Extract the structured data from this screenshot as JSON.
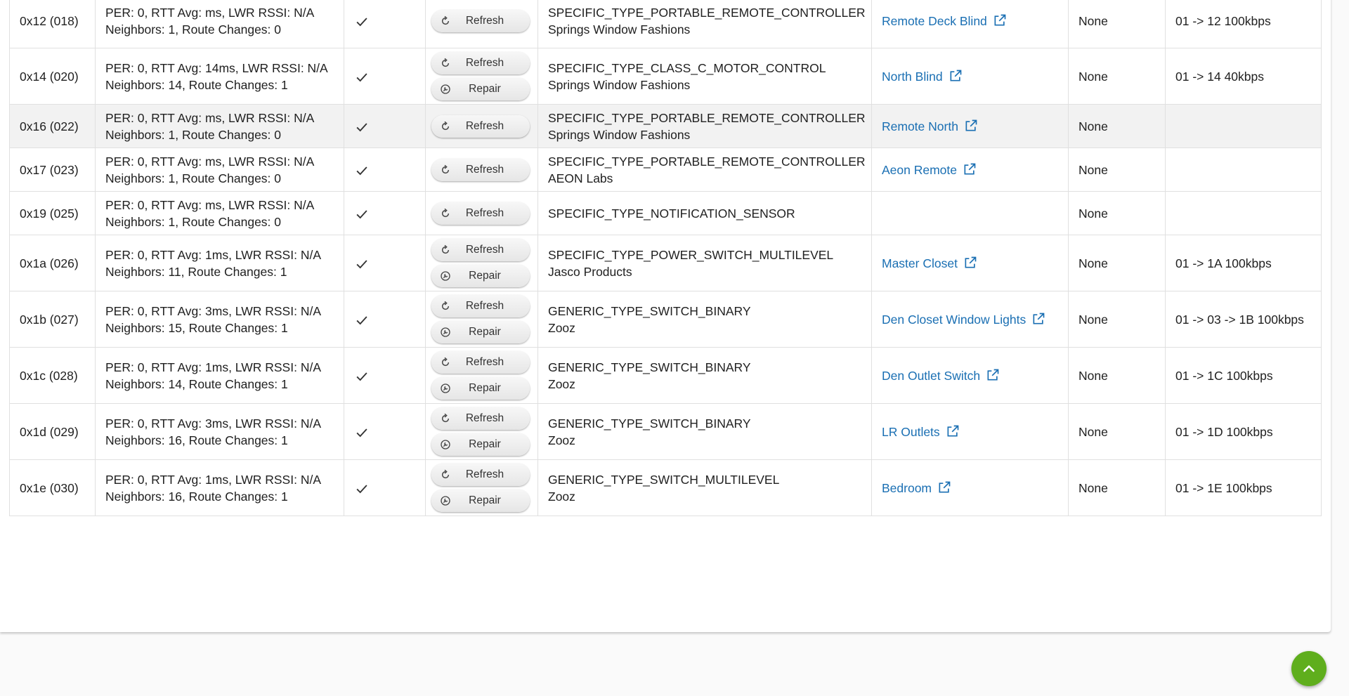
{
  "labels": {
    "refresh": "Refresh",
    "repair": "Repair"
  },
  "colors": {
    "link": "#1a6fb3",
    "fab": "#5fae1d",
    "row_shade": "#f2f2f2"
  },
  "icons": {
    "refresh": "refresh-icon",
    "repair": "repair-icon",
    "check": "check-icon",
    "external": "open-in-new-icon",
    "scroll_top": "chevron-up-icon"
  },
  "rows": [
    {
      "node": "0x12 (018)",
      "stats1": "PER: 0, RTT Avg: ms, LWR RSSI: N/A",
      "stats2": "Neighbors: 1, Route Changes: 0",
      "ready": true,
      "repair": false,
      "type": "SPECIFIC_TYPE_PORTABLE_REMOTE_CONTROLLER",
      "manufacturer": "Springs Window Fashions",
      "device": "Remote Deck Blind",
      "security": "None",
      "route": "01 -> 12 100kbps",
      "shaded": false
    },
    {
      "node": "0x14 (020)",
      "stats1": "PER: 0, RTT Avg: 14ms, LWR RSSI: N/A",
      "stats2": "Neighbors: 14, Route Changes: 1",
      "ready": true,
      "repair": true,
      "type": "SPECIFIC_TYPE_CLASS_C_MOTOR_CONTROL",
      "manufacturer": "Springs Window Fashions",
      "device": "North Blind",
      "security": "None",
      "route": "01 -> 14 40kbps",
      "shaded": false
    },
    {
      "node": "0x16 (022)",
      "stats1": "PER: 0, RTT Avg: ms, LWR RSSI: N/A",
      "stats2": "Neighbors: 1, Route Changes: 0",
      "ready": true,
      "repair": false,
      "type": "SPECIFIC_TYPE_PORTABLE_REMOTE_CONTROLLER",
      "manufacturer": "Springs Window Fashions",
      "device": "Remote North",
      "security": "None",
      "route": "",
      "shaded": true
    },
    {
      "node": "0x17 (023)",
      "stats1": "PER: 0, RTT Avg: ms, LWR RSSI: N/A",
      "stats2": "Neighbors: 1, Route Changes: 0",
      "ready": true,
      "repair": false,
      "type": "SPECIFIC_TYPE_PORTABLE_REMOTE_CONTROLLER",
      "manufacturer": "AEON Labs",
      "device": "Aeon Remote",
      "security": "None",
      "route": "",
      "shaded": false
    },
    {
      "node": "0x19 (025)",
      "stats1": "PER: 0, RTT Avg: ms, LWR RSSI: N/A",
      "stats2": "Neighbors: 1, Route Changes: 0",
      "ready": true,
      "repair": false,
      "type": "SPECIFIC_TYPE_NOTIFICATION_SENSOR",
      "manufacturer": "",
      "device": "",
      "security": "None",
      "route": "",
      "shaded": false
    },
    {
      "node": "0x1a (026)",
      "stats1": "PER: 0, RTT Avg: 1ms, LWR RSSI: N/A",
      "stats2": "Neighbors: 11, Route Changes: 1",
      "ready": true,
      "repair": true,
      "type": "SPECIFIC_TYPE_POWER_SWITCH_MULTILEVEL",
      "manufacturer": "Jasco Products",
      "device": "Master Closet",
      "security": "None",
      "route": "01 -> 1A 100kbps",
      "shaded": false
    },
    {
      "node": "0x1b (027)",
      "stats1": "PER: 0, RTT Avg: 3ms, LWR RSSI: N/A",
      "stats2": "Neighbors: 15, Route Changes: 1",
      "ready": true,
      "repair": true,
      "type": "GENERIC_TYPE_SWITCH_BINARY",
      "manufacturer": "Zooz",
      "device": "Den Closet Window Lights",
      "security": "None",
      "route": "01 -> 03 -> 1B 100kbps",
      "shaded": false
    },
    {
      "node": "0x1c (028)",
      "stats1": "PER: 0, RTT Avg: 1ms, LWR RSSI: N/A",
      "stats2": "Neighbors: 14, Route Changes: 1",
      "ready": true,
      "repair": true,
      "type": "GENERIC_TYPE_SWITCH_BINARY",
      "manufacturer": "Zooz",
      "device": "Den Outlet Switch",
      "security": "None",
      "route": "01 -> 1C 100kbps",
      "shaded": false
    },
    {
      "node": "0x1d (029)",
      "stats1": "PER: 0, RTT Avg: 3ms, LWR RSSI: N/A",
      "stats2": "Neighbors: 16, Route Changes: 1",
      "ready": true,
      "repair": true,
      "type": "GENERIC_TYPE_SWITCH_BINARY",
      "manufacturer": "Zooz",
      "device": "LR Outlets",
      "security": "None",
      "route": "01 -> 1D 100kbps",
      "shaded": false
    },
    {
      "node": "0x1e (030)",
      "stats1": "PER: 0, RTT Avg: 1ms, LWR RSSI: N/A",
      "stats2": "Neighbors: 16, Route Changes: 1",
      "ready": true,
      "repair": true,
      "type": "GENERIC_TYPE_SWITCH_MULTILEVEL",
      "manufacturer": "Zooz",
      "device": "Bedroom",
      "security": "None",
      "route": "01 -> 1E 100kbps",
      "shaded": false
    }
  ]
}
